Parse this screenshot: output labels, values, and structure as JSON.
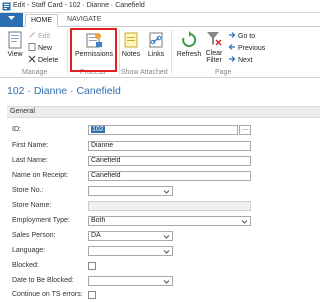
{
  "window": {
    "title": "Edit - Staff Card - 102 · Dianne · Canefield"
  },
  "tabs": [
    {
      "label": "HOME",
      "active": true
    },
    {
      "label": "NAVIGATE",
      "active": false
    }
  ],
  "ribbon": {
    "manage": {
      "group_label": "Manage",
      "view_label": "View",
      "edit_label": "Edit",
      "new_label": "New",
      "delete_label": "Delete"
    },
    "process": {
      "group_label": "Process",
      "permissions_label": "Permissions"
    },
    "show_attached": {
      "group_label": "Show Attached",
      "notes_label": "Notes",
      "links_label": "Links"
    },
    "page": {
      "group_label": "Page",
      "refresh_label": "Refresh",
      "clear_filter_label": "Clear",
      "clear_filter_label2": "Filter",
      "goto_label": "Go to",
      "previous_label": "Previous",
      "next_label": "Next"
    }
  },
  "record": {
    "title": "102 · Dianne · Canefield"
  },
  "section": {
    "title": "General"
  },
  "fields": {
    "id": {
      "label": "ID:",
      "value": "102"
    },
    "first_name": {
      "label": "First Name:",
      "value": "Dianne"
    },
    "last_name": {
      "label": "Last Name:",
      "value": "Canefield"
    },
    "name_on_receipt": {
      "label": "Name on Receipt:",
      "value": "Canefield"
    },
    "store_no": {
      "label": "Store No.:",
      "value": ""
    },
    "store_name": {
      "label": "Store Name:",
      "value": ""
    },
    "employment_type": {
      "label": "Employment Type:",
      "value": "Both"
    },
    "sales_person": {
      "label": "Sales Person:",
      "value": "DA"
    },
    "language": {
      "label": "Language:",
      "value": ""
    },
    "blocked": {
      "label": "Blocked:",
      "checked": false
    },
    "date_to_be_blocked": {
      "label": "Date to Be Blocked:",
      "value": ""
    },
    "continue_on_ts_errors": {
      "label": "Continue on TS errors:",
      "checked": false
    }
  },
  "colors": {
    "accent": "#2b6fb1",
    "title_blue": "#2f6fb0",
    "highlight_red": "#e02020"
  }
}
